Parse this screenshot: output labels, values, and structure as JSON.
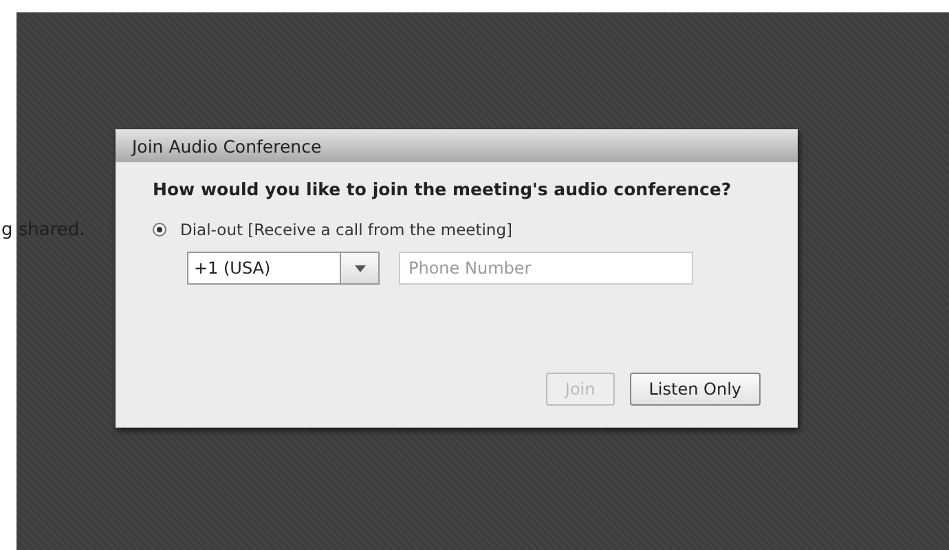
{
  "background_text": "g shared.",
  "dialog": {
    "title": "Join Audio Conference",
    "question": "How would you like to join the meeting's audio conference?",
    "options": [
      {
        "label": "Dial-out [Receive a call from the meeting]",
        "selected": true
      }
    ],
    "country_code": {
      "value": "+1 (USA)"
    },
    "phone": {
      "placeholder": "Phone Number"
    },
    "buttons": [
      {
        "label": "Join",
        "disabled": true
      },
      {
        "label": "Listen Only",
        "disabled": false
      }
    ]
  }
}
